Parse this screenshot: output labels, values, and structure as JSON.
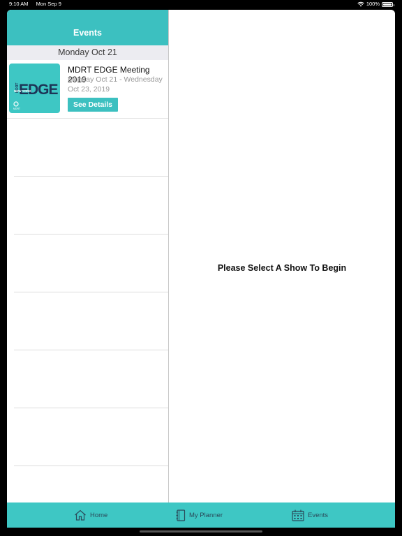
{
  "status_bar": {
    "time": "9:10 AM",
    "date": "Mon Sep 9",
    "battery": "100%",
    "battery_level": 1.0
  },
  "left_panel": {
    "title": "Events",
    "section_header": "Monday Oct 21",
    "events": [
      {
        "title": "MDRT EDGE Meeting 2019",
        "dates": "Monday Oct 21 - Wednesday Oct 23, 2019",
        "button_label": "See Details",
        "thumbnail_text": {
          "mdrt": "MDRT",
          "edge": "EDGE",
          "city": "NEW YORK",
          "logo": "MDRT"
        }
      }
    ]
  },
  "right_panel": {
    "prompt": "Please Select  A Show To Begin"
  },
  "tab_bar": {
    "items": [
      {
        "label": "Home",
        "icon": "home-icon"
      },
      {
        "label": "My Planner",
        "icon": "planner-icon"
      },
      {
        "label": "Events",
        "icon": "calendar-icon"
      }
    ],
    "selected": "Events"
  },
  "colors": {
    "accent": "#3cc0c0",
    "section_bg": "#ececf1",
    "tab_text": "#2a4a5a",
    "thumb_dark": "#1d3557"
  }
}
